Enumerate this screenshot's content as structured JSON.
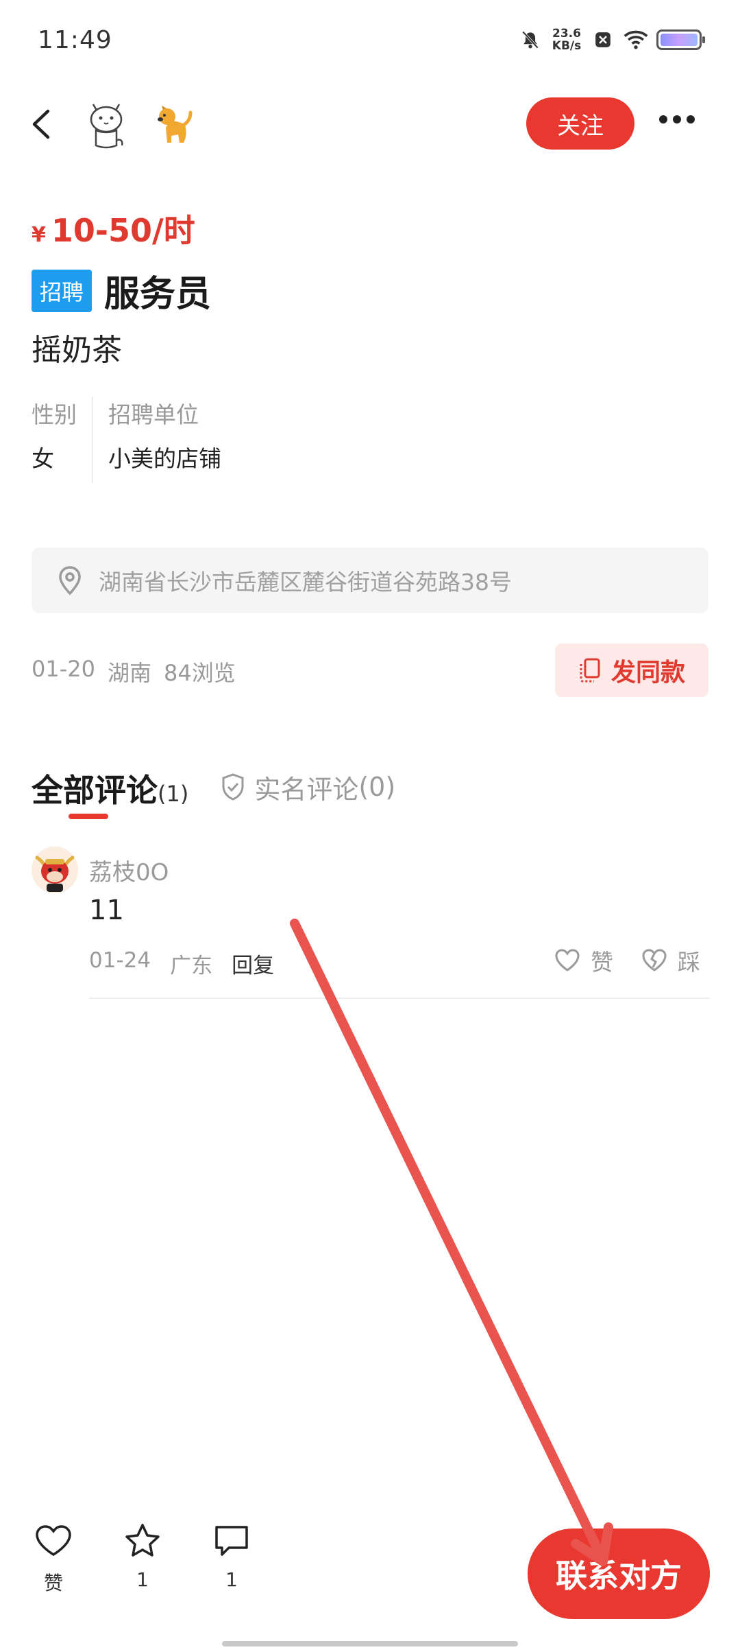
{
  "status_bar": {
    "time": "11:49",
    "speed_value": "23.6",
    "speed_unit": "KB/s",
    "icons": [
      "mute-icon",
      "x-box-icon",
      "wifi-icon",
      "battery-icon"
    ]
  },
  "header": {
    "follow_label": "关注",
    "icons": [
      "back-icon",
      "cat-avatar",
      "dog-avatar",
      "more-icon"
    ]
  },
  "job": {
    "currency": "¥",
    "price": "10-50/时",
    "tag": "招聘",
    "title": "服务员",
    "subtitle": "摇奶茶",
    "attributes": [
      {
        "key": "性别",
        "value": "女"
      },
      {
        "key": "招聘单位",
        "value": "小美的店铺"
      }
    ],
    "address": "湖南省长沙市岳麓区麓谷街道谷苑路38号",
    "date": "01-20",
    "region": "湖南",
    "views": "84浏览",
    "same_button": "发同款"
  },
  "comments": {
    "tab_all": "全部评论",
    "tab_all_count": "(1)",
    "tab_real": "实名评论",
    "tab_real_count": "(0)",
    "items": [
      {
        "user": "荔枝0O",
        "text": "11",
        "date": "01-24",
        "region": "广东",
        "reply": "回复",
        "like": "赞",
        "dislike": "踩"
      }
    ]
  },
  "bottom_bar": {
    "like_label": "赞",
    "favorite_count": "1",
    "comment_count": "1",
    "contact_label": "联系对方"
  },
  "colors": {
    "accent": "#e8382f",
    "tag_blue": "#1e9cf0",
    "muted": "#999999"
  }
}
